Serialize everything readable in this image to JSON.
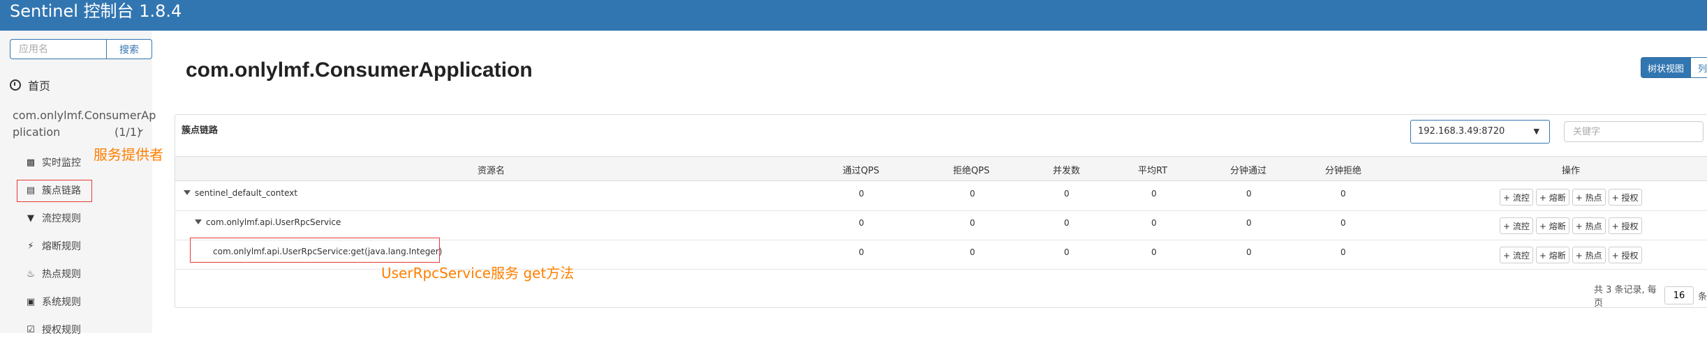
{
  "app_title": "Sentinel 控制台 1.8.4",
  "sidebar": {
    "search_placeholder": "应用名",
    "search_button": "搜索",
    "home": "首页",
    "app_name_line1": "com.onlylmf.ConsumerAp",
    "app_name_line2": "plication",
    "app_count": "(1/1)",
    "items": [
      {
        "label": "实时监控",
        "icon": "chart-icon"
      },
      {
        "label": "簇点链路",
        "icon": "list-icon"
      },
      {
        "label": "流控规则",
        "icon": "filter-icon"
      },
      {
        "label": "熔断规则",
        "icon": "bolt-icon"
      },
      {
        "label": "热点规则",
        "icon": "fire-icon"
      },
      {
        "label": "系统规则",
        "icon": "lock-icon"
      },
      {
        "label": "授权规则",
        "icon": "check-icon"
      }
    ]
  },
  "annotations": {
    "provider": "服务提供者",
    "method": "UserRpcService服务 get方法"
  },
  "main": {
    "page_title": "com.onlylmf.ConsumerApplication",
    "view_tree": "树状视图",
    "view_list": "列"
  },
  "panel": {
    "title": "簇点链路",
    "machine": "192.168.3.49:8720",
    "keyword_placeholder": "关键字",
    "columns": [
      "资源名",
      "通过QPS",
      "拒绝QPS",
      "并发数",
      "平均RT",
      "分钟通过",
      "分钟拒绝",
      "操作"
    ],
    "rows": [
      {
        "name": "sentinel_default_context",
        "values": [
          "0",
          "0",
          "0",
          "0",
          "0",
          "0"
        ],
        "caret": true
      },
      {
        "name": "com.onlylmf.api.UserRpcService",
        "values": [
          "0",
          "0",
          "0",
          "0",
          "0",
          "0"
        ],
        "caret": true
      },
      {
        "name": "com.onlylmf.api.UserRpcService:get(java.lang.Integer)",
        "values": [
          "0",
          "0",
          "0",
          "0",
          "0",
          "0"
        ],
        "caret": false
      }
    ],
    "ops": [
      "+ 流控",
      "+ 熔断",
      "+ 热点",
      "+ 授权"
    ],
    "pager_text": "共 3 条记录, 每页",
    "page_size": "16",
    "pager_suffix": "条"
  }
}
